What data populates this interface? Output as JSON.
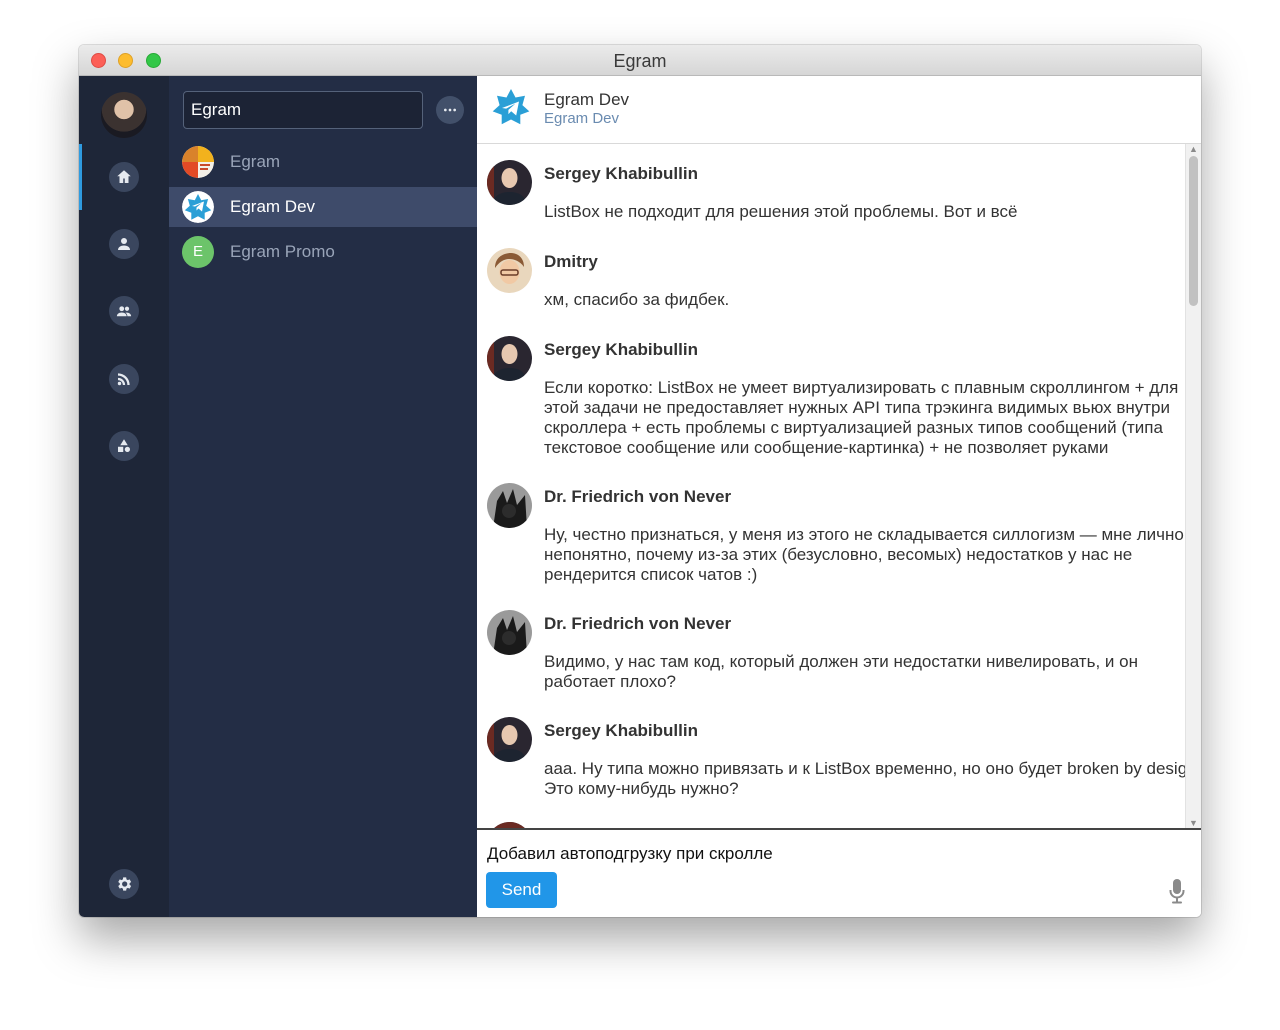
{
  "window": {
    "title": "Egram"
  },
  "colors": {
    "accent": "#2196e8",
    "nav_bg": "#1e2638",
    "list_bg": "#232d45",
    "active_item": "#3e4b6a"
  },
  "nav": {
    "items": [
      {
        "icon": "home-icon",
        "active": true
      },
      {
        "icon": "person-icon",
        "active": false
      },
      {
        "icon": "group-icon",
        "active": false
      },
      {
        "icon": "rss-icon",
        "active": false
      },
      {
        "icon": "shapes-icon",
        "active": false
      }
    ],
    "settings_icon": "gear-icon"
  },
  "chatlist": {
    "search_value": "Egram",
    "items": [
      {
        "name": "Egram",
        "active": false
      },
      {
        "name": "Egram Dev",
        "active": true
      },
      {
        "name": "Egram Promo",
        "initial": "E",
        "active": false
      }
    ]
  },
  "chat": {
    "title": "Egram Dev",
    "subtitle": "Egram Dev",
    "messages": [
      {
        "author": "Sergey Khabibullin",
        "text": "ListBox не подходит для решения этой проблемы. Вот и всё"
      },
      {
        "author": "Dmitry",
        "text": "хм, спасибо за фидбек."
      },
      {
        "author": "Sergey Khabibullin",
        "text": "Если коротко: ListBox не умеет виртуализировать с плавным скроллингом + для этой задачи не предоставляет нужных API типа трэкинга видимых вьюх внутри скроллера + есть проблемы с виртуализацией разных типов сообщений (типа текстовое сообщение или сообщение-картинка) + не позволяет руками"
      },
      {
        "author": "Dr. Friedrich von Never",
        "text": "Ну, честно признаться, у меня из этого не складывается силлогизм — мне лично непонятно, почему из-за этих (безусловно, весомых) недостатков у нас не рендерится список чатов :)"
      },
      {
        "author": "Dr. Friedrich von Never",
        "text": "Видимо, у нас там код, который должен эти недостатки нивелировать, и он работает плохо?"
      },
      {
        "author": "Sergey Khabibullin",
        "text": "ааа. Ну типа можно привязать и к ListBox временно, но оно будет broken by design. Это кому-нибудь нужно?"
      }
    ]
  },
  "composer": {
    "value": "Добавил автоподгрузку при скролле",
    "send_label": "Send"
  }
}
